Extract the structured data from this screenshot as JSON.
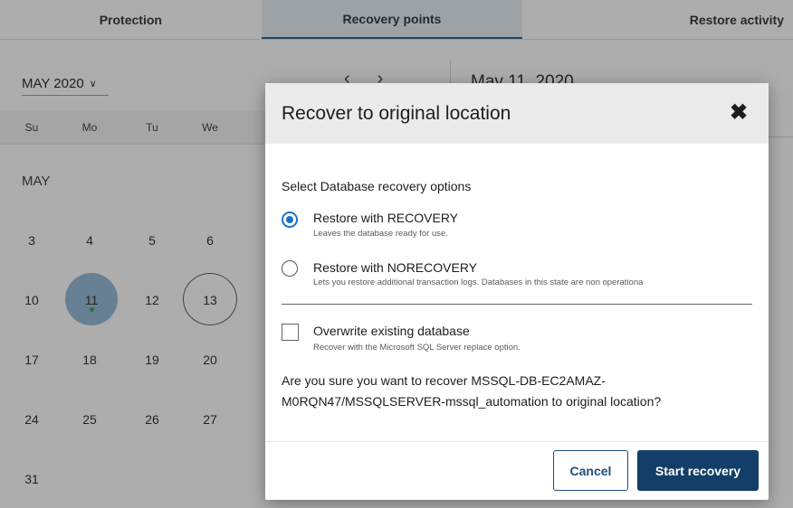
{
  "tabs": [
    "Protection",
    "Recovery points",
    "Restore activity"
  ],
  "calendar": {
    "month_select": "MAY 2020",
    "nav_prev": "‹",
    "nav_next": "›",
    "selected_date_title": "May 11, 2020",
    "weekdays": [
      "Su",
      "Mo",
      "Tu",
      "We"
    ],
    "month_label": "MAY",
    "rows": [
      [
        "3",
        "4",
        "5",
        "6"
      ],
      [
        "10",
        "11",
        "12",
        "13"
      ],
      [
        "17",
        "18",
        "19",
        "20"
      ],
      [
        "24",
        "25",
        "26",
        "27"
      ],
      [
        "31"
      ]
    ],
    "selected_day": "11",
    "outlined_day": "13"
  },
  "modal": {
    "title": "Recover to original location",
    "close_glyph": "✖",
    "section_label": "Select Database recovery options",
    "options": [
      {
        "label": "Restore with RECOVERY",
        "description": "Leaves the database ready for use.",
        "checked": true
      },
      {
        "label": "Restore with NORECOVERY",
        "description": "Lets you restore additional transaction logs. Databases in this state are non operationa",
        "checked": false
      }
    ],
    "overwrite": {
      "label": "Overwrite existing database",
      "description": "Recover with the Microsoft SQL Server replace option.",
      "checked": false
    },
    "confirm_line1": "Are you sure you want to recover MSSQL-DB-EC2AMAZ-",
    "confirm_line2": "M0RQN47/MSSQLSERVER-mssql_automation to original location?",
    "cancel_label": "Cancel",
    "start_label": "Start recovery"
  },
  "colors": {
    "accent": "#1a73c9",
    "primary_button": "#123e67",
    "selected_day": "#8eb7d6",
    "recovery_point_dot": "#2ea043"
  }
}
